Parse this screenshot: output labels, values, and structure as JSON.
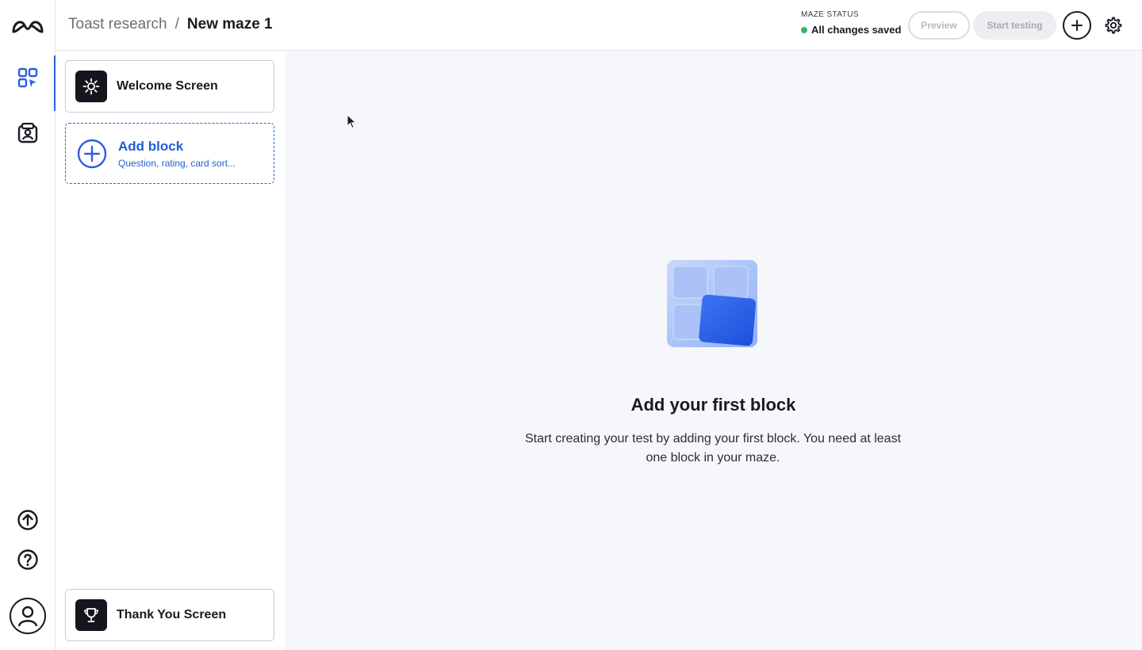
{
  "header": {
    "project": "Toast research",
    "separator": "/",
    "maze_name": "New maze 1",
    "status_label": "MAZE STATUS",
    "status_text": "All changes saved",
    "status_color": "#3bb26a",
    "preview_label": "Preview",
    "start_label": "Start testing",
    "add_icon": "plus-icon",
    "settings_icon": "gear-icon"
  },
  "rail": {
    "logo_icon": "maze-logo",
    "items": [
      {
        "name": "blocks-grid-icon",
        "active": true
      },
      {
        "name": "participants-icon",
        "active": false
      },
      {
        "name": "upgrade-arrow-icon",
        "active": false
      },
      {
        "name": "help-icon",
        "active": false
      },
      {
        "name": "profile-avatar-icon",
        "active": false
      }
    ]
  },
  "blocks": {
    "welcome_label": "Welcome Screen",
    "add_title": "Add block",
    "add_subtitle": "Question, rating, card sort...",
    "thanks_label": "Thank You Screen"
  },
  "main": {
    "empty_title": "Add your first block",
    "empty_desc": "Start creating your test by adding your first block. You need at least one block in your maze."
  },
  "colors": {
    "accent": "#2c5fe0",
    "canvas_bg": "#f6f7fa",
    "dark_icon_bg": "#15161d"
  }
}
